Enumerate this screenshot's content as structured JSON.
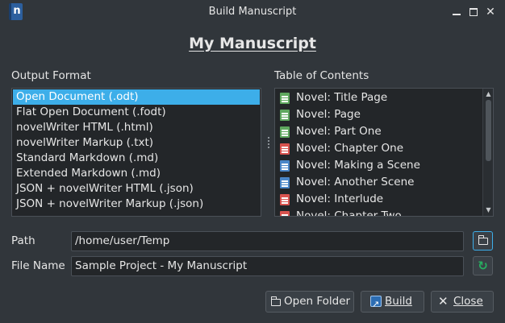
{
  "window": {
    "title": "Build Manuscript",
    "app_icon_letter": "n",
    "minimize_icon": "minimize-icon",
    "maximize_icon": "maximize-icon",
    "close_icon": "close-icon"
  },
  "heading": "My Manuscript",
  "output_format": {
    "label": "Output Format",
    "selected_index": 0,
    "items": [
      "Open Document (.odt)",
      "Flat Open Document (.fodt)",
      "novelWriter HTML (.html)",
      "novelWriter Markup (.txt)",
      "Standard Markdown (.md)",
      "Extended Markdown (.md)",
      "JSON + novelWriter HTML (.json)",
      "JSON + novelWriter Markup (.json)"
    ]
  },
  "toc": {
    "label": "Table of Contents",
    "items": [
      {
        "label": "Novel: Title Page",
        "color": "#5fa85f"
      },
      {
        "label": "Novel: Page",
        "color": "#5fa85f"
      },
      {
        "label": "Novel: Part One",
        "color": "#5fa85f"
      },
      {
        "label": "Novel: Chapter One",
        "color": "#d9534f"
      },
      {
        "label": "Novel: Making a Scene",
        "color": "#4a86c8"
      },
      {
        "label": "Novel: Another Scene",
        "color": "#4a86c8"
      },
      {
        "label": "Novel: Interlude",
        "color": "#d9534f"
      },
      {
        "label": "Novel: Chapter Two",
        "color": "#d9534f"
      }
    ]
  },
  "path": {
    "label": "Path",
    "value": "/home/user/Temp",
    "button_icon": "folder-icon"
  },
  "filename": {
    "label": "File Name",
    "value": "Sample Project - My Manuscript",
    "button_icon": "reset-icon"
  },
  "buttons": {
    "open_folder": "Open Folder",
    "build": "Build",
    "close": "Close"
  },
  "colors": {
    "accent": "#3daee9",
    "background": "#31363b",
    "field_background": "#232629"
  }
}
